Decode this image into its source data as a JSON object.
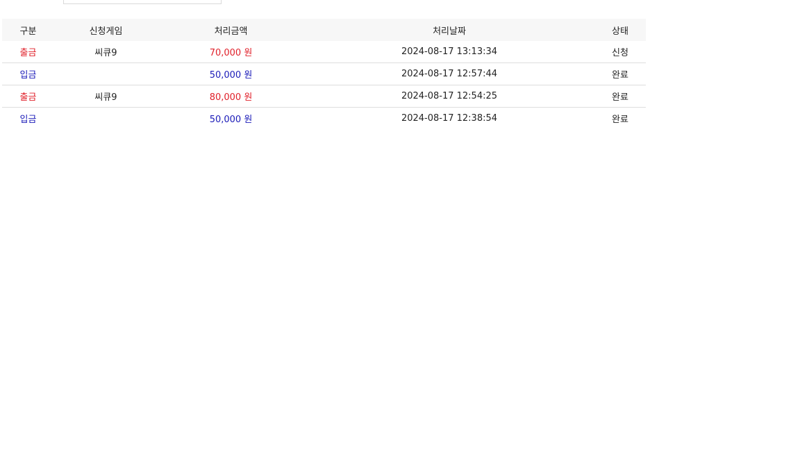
{
  "colors": {
    "withdraw": "#e0202a",
    "deposit": "#1a1ab8",
    "text": "#222222",
    "header_bg": "#f7f7f7",
    "row_border": "#dddddd"
  },
  "table": {
    "headers": {
      "type": "구분",
      "game": "신청게임",
      "amount": "처리금액",
      "date": "처리날짜",
      "status": "상태"
    },
    "rows": [
      {
        "type": "출금",
        "kind": "withdraw",
        "game": "씨큐9",
        "amount": "70,000 원",
        "date": "2024-08-17 13:13:34",
        "status": "신청"
      },
      {
        "type": "입금",
        "kind": "deposit",
        "game": "",
        "amount": "50,000 원",
        "date": "2024-08-17 12:57:44",
        "status": "완료"
      },
      {
        "type": "출금",
        "kind": "withdraw",
        "game": "씨큐9",
        "amount": "80,000 원",
        "date": "2024-08-17 12:54:25",
        "status": "완료"
      },
      {
        "type": "입금",
        "kind": "deposit",
        "game": "",
        "amount": "50,000 원",
        "date": "2024-08-17 12:38:54",
        "status": "완료"
      }
    ]
  }
}
